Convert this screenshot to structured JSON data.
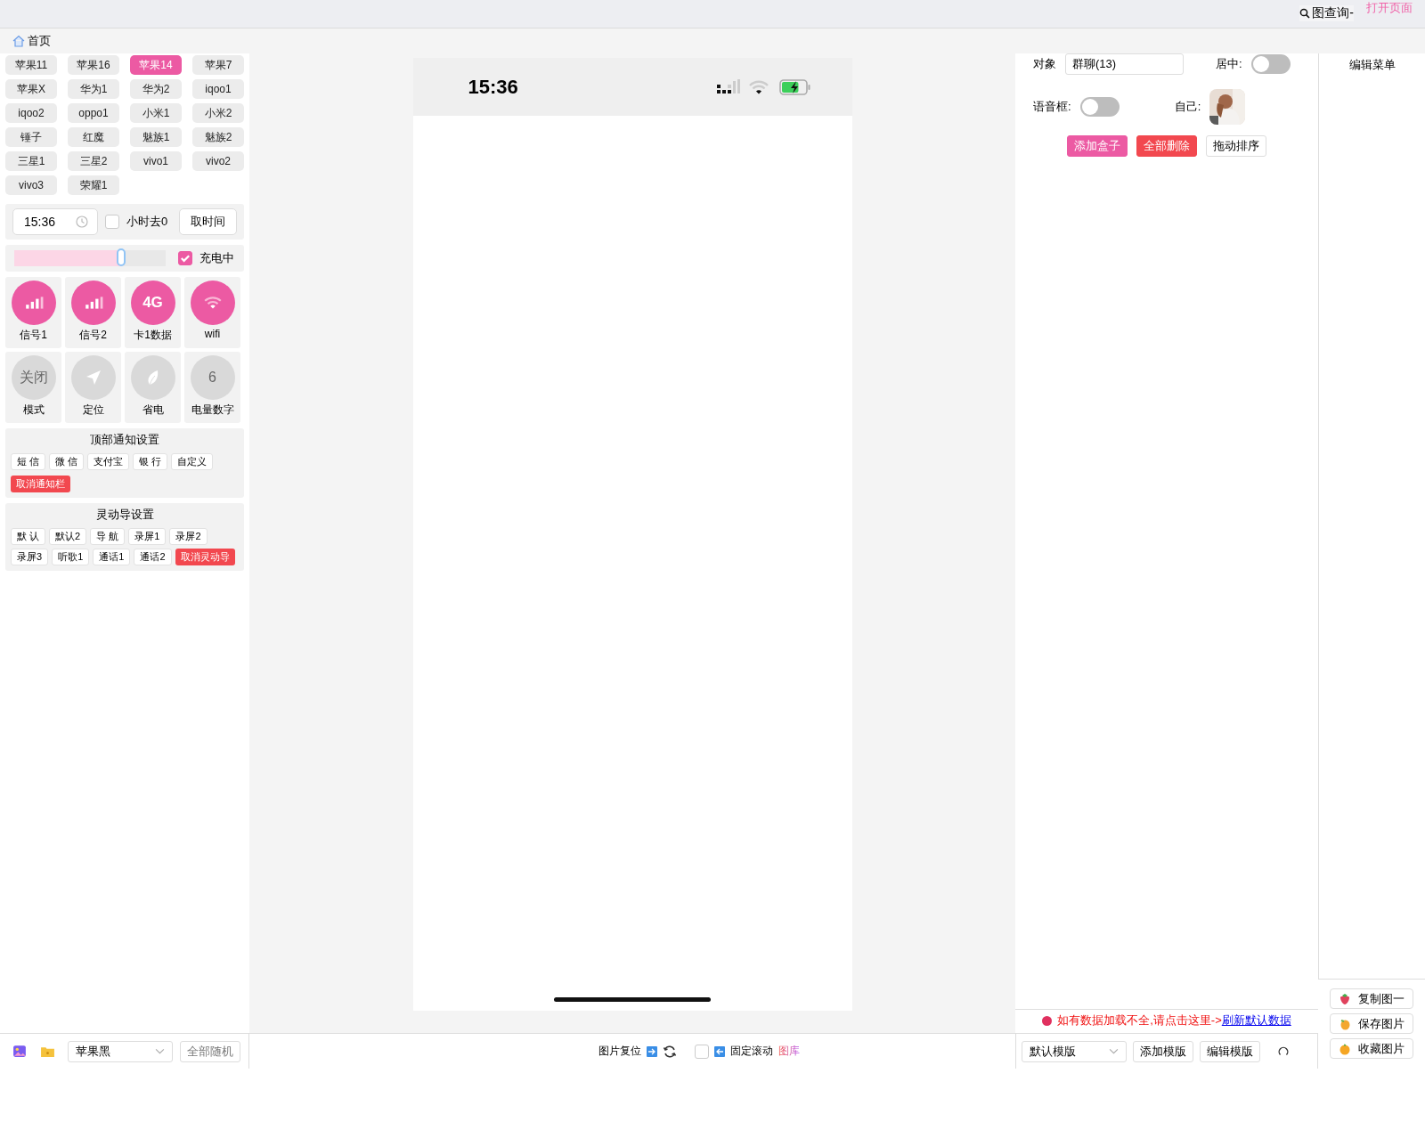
{
  "top_bar": {
    "search": "图查询-",
    "open_link": "打开页面"
  },
  "breadcrumb": "首页",
  "models": [
    {
      "label": "苹果11",
      "selected": false
    },
    {
      "label": "苹果16",
      "selected": false
    },
    {
      "label": "苹果14",
      "selected": true
    },
    {
      "label": "苹果7",
      "selected": false
    },
    {
      "label": "苹果X",
      "selected": false
    },
    {
      "label": "华为1",
      "selected": false
    },
    {
      "label": "华为2",
      "selected": false
    },
    {
      "label": "iqoo1",
      "selected": false
    },
    {
      "label": "iqoo2",
      "selected": false
    },
    {
      "label": "oppo1",
      "selected": false
    },
    {
      "label": "小米1",
      "selected": false
    },
    {
      "label": "小米2",
      "selected": false
    },
    {
      "label": "锤子",
      "selected": false
    },
    {
      "label": "红魔",
      "selected": false
    },
    {
      "label": "魅族1",
      "selected": false
    },
    {
      "label": "魅族2",
      "selected": false
    },
    {
      "label": "三星1",
      "selected": false
    },
    {
      "label": "三星2",
      "selected": false
    },
    {
      "label": "vivo1",
      "selected": false
    },
    {
      "label": "vivo2",
      "selected": false
    },
    {
      "label": "vivo3",
      "selected": false
    },
    {
      "label": "荣耀1",
      "selected": false
    }
  ],
  "time": {
    "value": "15:36",
    "hour_zero": {
      "label": "小时去0",
      "checked": false
    },
    "button": "取时间"
  },
  "battery": {
    "level": 0.71,
    "charging": {
      "label": "充电中",
      "checked": true
    }
  },
  "tiles": [
    {
      "kind": "signal",
      "label": "信号1",
      "on": true
    },
    {
      "kind": "signal",
      "label": "信号2",
      "on": true
    },
    {
      "kind": "text",
      "text": "4G",
      "label": "卡1数据",
      "on": true
    },
    {
      "kind": "wifi",
      "label": "wifi",
      "on": true
    },
    {
      "kind": "text",
      "text": "关闭",
      "label": "模式",
      "on": false
    },
    {
      "kind": "location",
      "label": "定位",
      "on": false
    },
    {
      "kind": "leaf",
      "label": "省电",
      "on": false
    },
    {
      "kind": "text",
      "text": "6",
      "label": "电量数字",
      "on": false
    }
  ],
  "notification": {
    "title": "顶部通知设置",
    "options": [
      "短 信",
      "微 信",
      "支付宝",
      "银 行",
      "自定义"
    ],
    "cancel": "取消通知栏"
  },
  "island": {
    "title": "灵动导设置",
    "options": [
      "默 认",
      "默认2",
      "导 航",
      "录屏1",
      "录屏2",
      "录屏3",
      "听歌1",
      "通话1",
      "通话2"
    ],
    "cancel": "取消灵动导"
  },
  "phone": {
    "time": "15:36"
  },
  "settings": {
    "target_label": "对象",
    "target_value": "群聊(13)",
    "center": {
      "label": "居中:",
      "on": false
    },
    "voice": {
      "label": "语音框:",
      "on": false
    },
    "self_label": "自己:",
    "buttons": [
      {
        "label": "添加盒子",
        "kind": "pink"
      },
      {
        "label": "全部删除",
        "kind": "red"
      },
      {
        "label": "拖动排序",
        "kind": "plain"
      }
    ]
  },
  "notice": {
    "text": "如有数据加载不全,请点击这里->",
    "link": "刷新默认数据"
  },
  "menu": {
    "title": "编辑菜单",
    "actions": [
      {
        "label": "复制图一",
        "kind": "strawberry"
      },
      {
        "label": "保存图片",
        "kind": "mango"
      },
      {
        "label": "收藏图片",
        "kind": "orange"
      }
    ]
  },
  "bottom": {
    "theme": "苹果黑",
    "random": "全部随机",
    "reset": "图片复位",
    "fixed_scroll": {
      "label": "固定滚动",
      "checked": false
    },
    "gallery": "图库",
    "template": "默认模版",
    "add_template": "添加模版",
    "edit_template": "编辑模版"
  }
}
